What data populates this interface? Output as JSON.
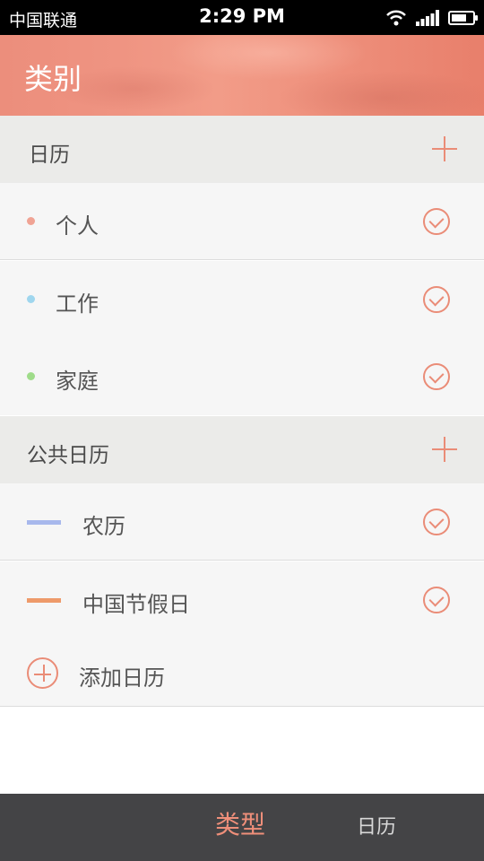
{
  "status_bar": {
    "carrier": "中国联通",
    "time": "2:29 PM",
    "icons": [
      "wifi-icon",
      "signal-icon",
      "battery-icon"
    ]
  },
  "header": {
    "title": "类别"
  },
  "sections": [
    {
      "title": "日历",
      "items": [
        {
          "label": "个人",
          "marker": "dot",
          "color": "#f0a394",
          "checked": true
        },
        {
          "label": "工作",
          "marker": "dot",
          "color": "#9fd6ee",
          "checked": true
        },
        {
          "label": "家庭",
          "marker": "dot",
          "color": "#9fdc8a",
          "checked": true
        }
      ]
    },
    {
      "title": "公共日历",
      "items": [
        {
          "label": "农历",
          "marker": "bar",
          "color": "#a8b8ec",
          "checked": true
        },
        {
          "label": "中国节假日",
          "marker": "bar",
          "color": "#ee9a6a",
          "checked": true
        }
      ]
    }
  ],
  "add_calendar": {
    "label": "添加日历"
  },
  "tabs": [
    {
      "label": "类型",
      "active": true
    },
    {
      "label": "日历",
      "active": false
    }
  ],
  "colors": {
    "accent": "#ea8c77",
    "tabbar": "#444446",
    "section_bg": "#ebebe9",
    "row_bg": "#f6f6f6"
  }
}
